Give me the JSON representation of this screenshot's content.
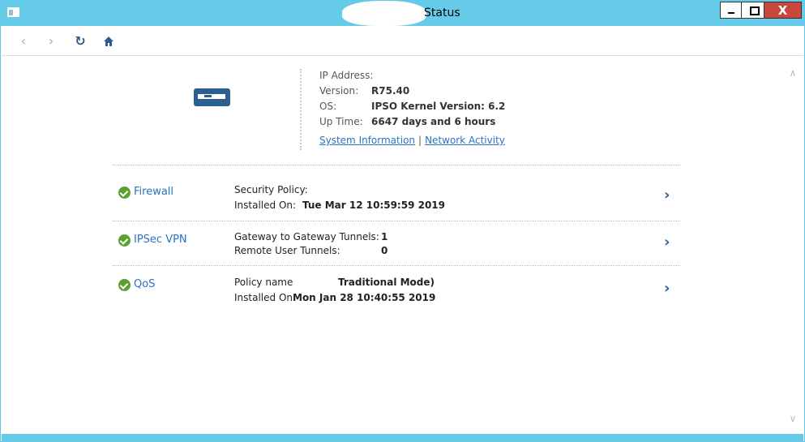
{
  "window": {
    "title": "Status",
    "close_glyph": "X"
  },
  "nav": {
    "back_icon": "chevron-left-icon",
    "forward_icon": "chevron-right-icon",
    "refresh_icon": "refresh-icon",
    "home_icon": "home-icon"
  },
  "device": {
    "ip_label": "IP Address:",
    "version_label": "Version:",
    "version_value": "R75.40",
    "os_label": "OS:",
    "os_value": "IPSO Kernel Version: 6.2",
    "uptime_label": "Up Time:",
    "uptime_value": "6647 days and 6 hours",
    "link_system": "System Information",
    "link_separator": "|",
    "link_network": "Network Activity"
  },
  "blades": [
    {
      "name": "Firewall",
      "line1_label": "Security Policy:",
      "line1_value": "",
      "line2_label": "Installed On:",
      "line2_value": "Tue Mar 12 10:59:59 2019"
    },
    {
      "name": "IPSec VPN",
      "line1_label": "Gateway to Gateway Tunnels:",
      "line1_value": "1",
      "line2_label": "Remote User Tunnels:",
      "line2_value": "0"
    },
    {
      "name": "QoS",
      "line1_label": "Policy name",
      "line1_value": "Traditional Mode)",
      "line2_label": "Installed On:",
      "line2_value": "Mon Jan 28 10:40:55 2019"
    }
  ],
  "colors": {
    "titlebar": "#65cbe9",
    "link": "#2a72c4",
    "ok": "#5ba033",
    "icon": "#2d5e92"
  }
}
